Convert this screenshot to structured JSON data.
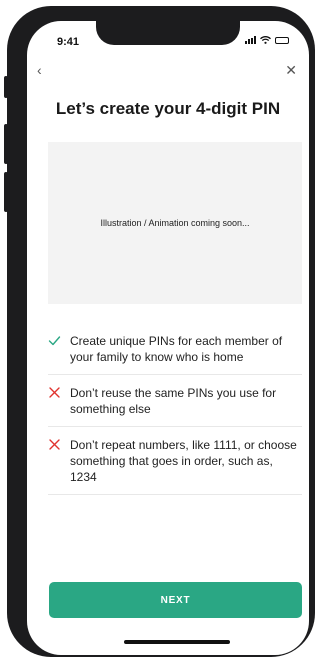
{
  "status_bar": {
    "time": "9:41"
  },
  "nav": {
    "back_glyph": "‹",
    "close_glyph": "✕"
  },
  "title": "Let’s create your 4-digit PIN",
  "illustration": {
    "placeholder": "Illustration / Animation coming soon..."
  },
  "tips": [
    {
      "kind": "do",
      "icon": "check-icon",
      "text": "Create unique PINs for each member of your family to know who is home"
    },
    {
      "kind": "dont",
      "icon": "cross-icon",
      "text": "Don’t reuse the same PINs you use for something else"
    },
    {
      "kind": "dont",
      "icon": "cross-icon",
      "text": "Don’t repeat numbers, like 1111, or choose something that goes in order, such as, 1234"
    }
  ],
  "next_button": {
    "label": "NEXT"
  },
  "colors": {
    "accent": "#2aa784",
    "check": "#2aa784",
    "cross": "#e0332e",
    "illustration_bg": "#f3f3f3"
  }
}
